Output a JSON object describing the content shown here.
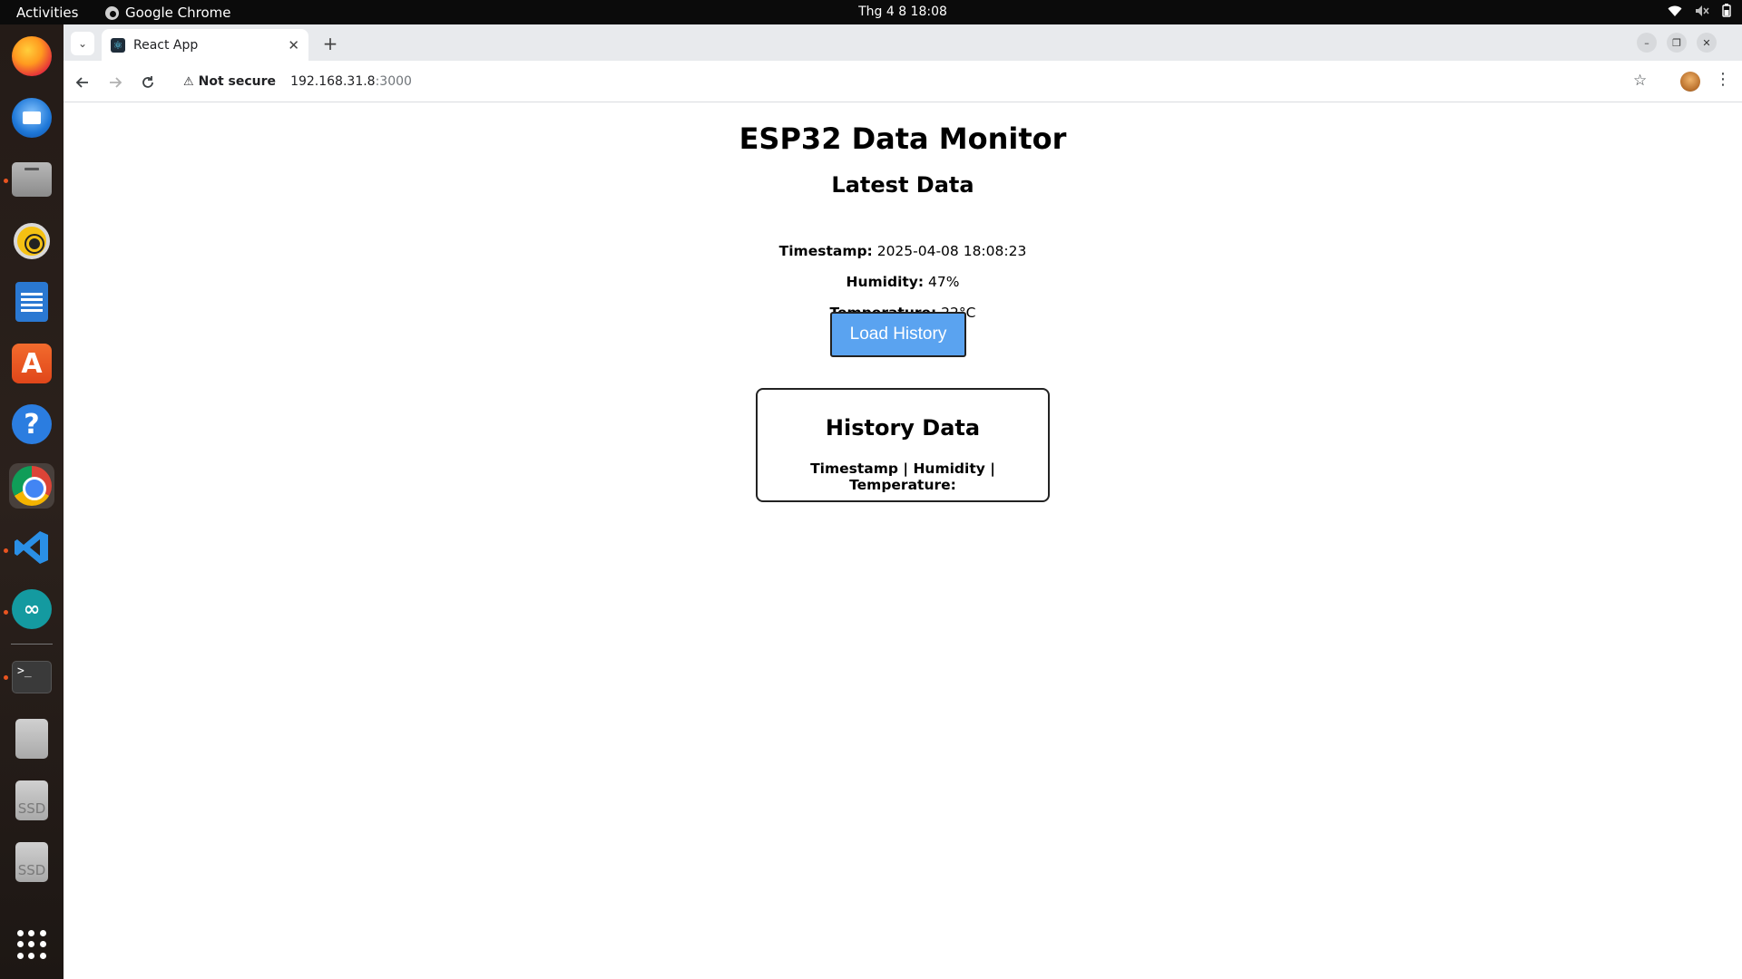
{
  "topbar": {
    "activities": "Activities",
    "app_name": "Google Chrome",
    "clock": "Thg 4 8  18:08"
  },
  "dock": {
    "items": [
      {
        "name": "firefox",
        "icon": "firefox-icon"
      },
      {
        "name": "thunderbird",
        "icon": "thunderbird-icon"
      },
      {
        "name": "files",
        "icon": "files-icon"
      },
      {
        "name": "rhythmbox",
        "icon": "rhythmbox-icon"
      },
      {
        "name": "libreoffice-writer",
        "icon": "writer-icon"
      },
      {
        "name": "app-center",
        "icon": "app-store-icon"
      },
      {
        "name": "help",
        "icon": "help-icon"
      },
      {
        "name": "google-chrome",
        "icon": "chrome-icon"
      },
      {
        "name": "vscode",
        "icon": "vscode-icon"
      },
      {
        "name": "arduino",
        "icon": "arduino-icon"
      },
      {
        "name": "terminal",
        "icon": "terminal-icon"
      },
      {
        "name": "drive",
        "icon": "drive-icon"
      },
      {
        "name": "ssd-1",
        "icon": "ssd-icon",
        "label": "SSD"
      },
      {
        "name": "ssd-2",
        "icon": "ssd-icon",
        "label": "SSD"
      },
      {
        "name": "show-apps",
        "icon": "app-grid-icon"
      }
    ],
    "store_glyph": "A",
    "help_glyph": "?",
    "terminal_glyph": ">_",
    "arduino_glyph": "∞"
  },
  "browser": {
    "tab_title": "React App",
    "security_label": "Not secure",
    "url_host": "192.168.31.8",
    "url_port": ":3000"
  },
  "page": {
    "title": "ESP32 Data Monitor",
    "latest_title": "Latest Data",
    "timestamp_label": "Timestamp:",
    "timestamp_value": "2025-04-08 18:08:23",
    "humidity_label": "Humidity:",
    "humidity_value": "47%",
    "temperature_label": "Temperature:",
    "temperature_value": "22°C",
    "load_button": "Load History",
    "history_title": "History Data",
    "history_header": "Timestamp | Humidity | Temperature:"
  },
  "colors": {
    "button_bg": "#5aa3f0",
    "topbar_bg": "#0b0b0b",
    "tabstrip_bg": "#e8eaed",
    "accent_dot": "#e95420"
  }
}
